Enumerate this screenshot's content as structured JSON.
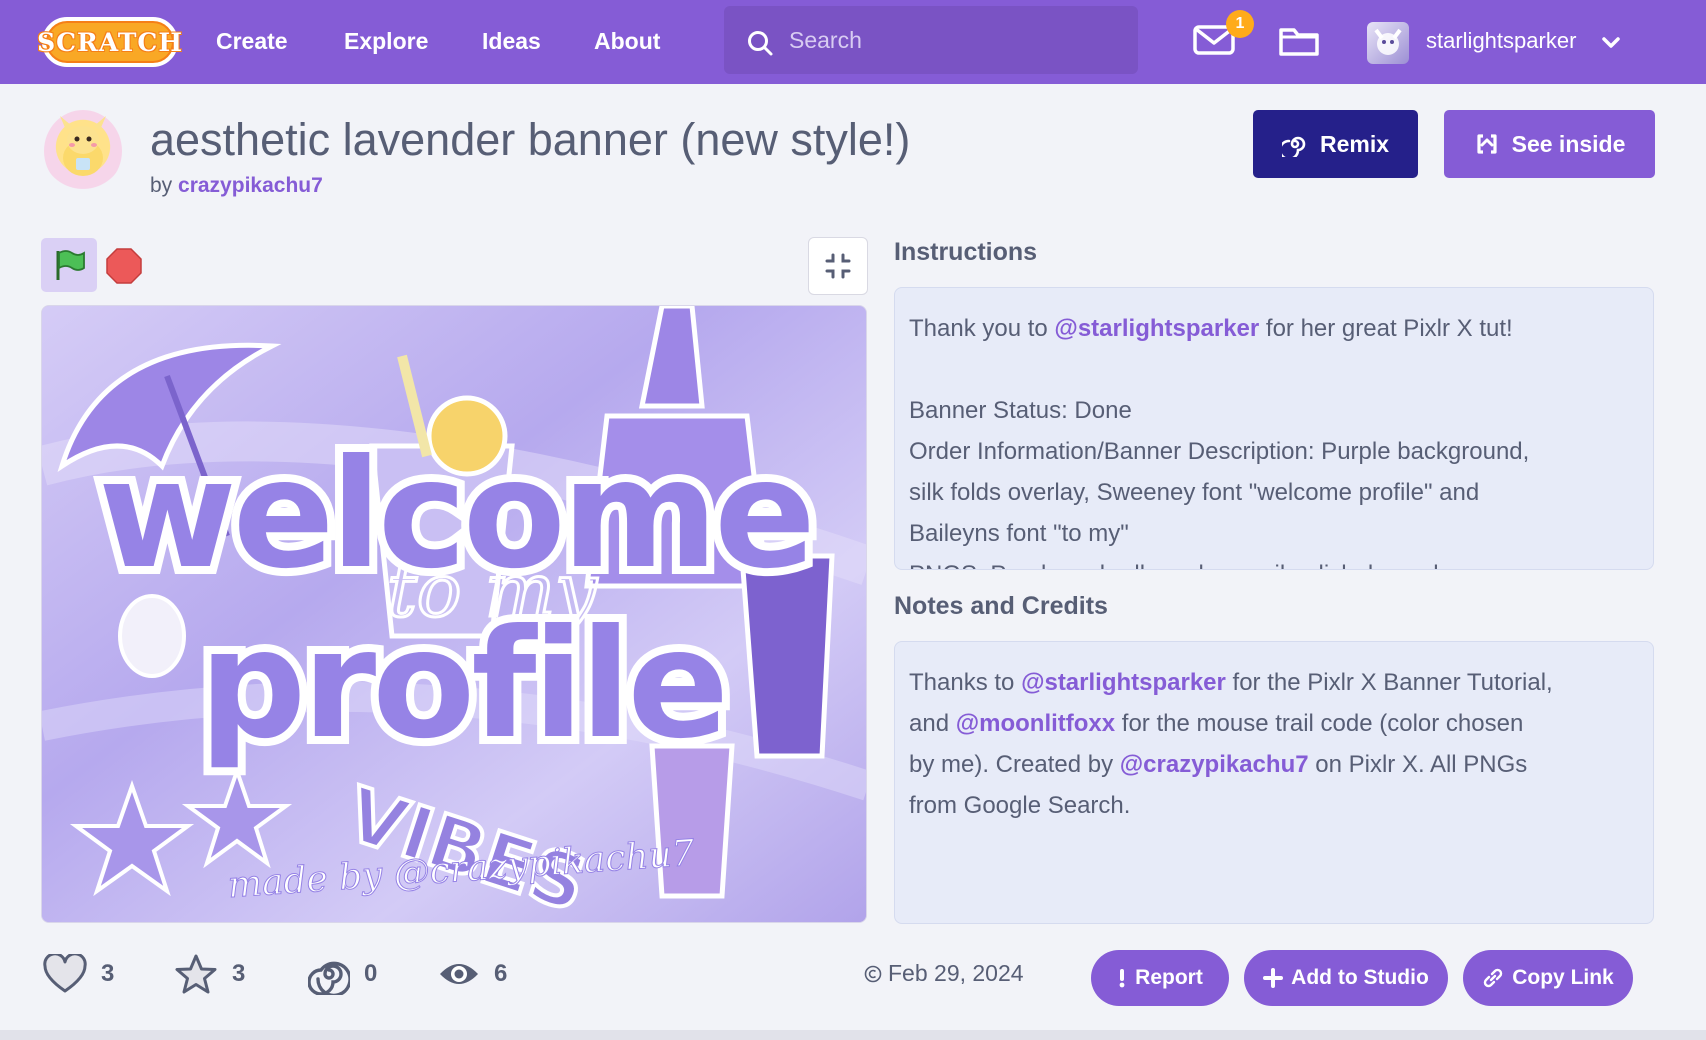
{
  "nav": {
    "logo_text": "SCRATCH",
    "links": [
      "Create",
      "Explore",
      "Ideas",
      "About"
    ],
    "search_placeholder": "Search",
    "messages_count": "1",
    "username": "starlightsparker"
  },
  "project": {
    "title": "aesthetic lavender banner (new style!)",
    "by_prefix": "by",
    "author": "crazypikachu7",
    "remix_label": "Remix",
    "see_inside_label": "See inside"
  },
  "instructions": {
    "heading": "Instructions",
    "line1_pre": "Thank you to ",
    "line1_mention": "@starlightsparker",
    "line1_post": " for her great Pixlr X tut!",
    "line3": "Banner Status: Done",
    "line4": "Order Information/Banner Description: Purple background,",
    "line5": "silk folds overlay, Sweeney font \"welcome profile\" and",
    "line6": "Baileyns font \"to my\"",
    "line7": "PNGS: Purple umbrella, galaxy nail polish, lavender"
  },
  "notes": {
    "heading": "Notes and Credits",
    "l1_pre": "Thanks to ",
    "l1_mention": "@starlightsparker",
    "l1_post": " for the Pixlr X Banner Tutorial,",
    "l2_pre": "and ",
    "l2_mention": "@moonlitfoxx",
    "l2_post": " for the mouse trail code (color chosen",
    "l3_pre": "by me). Created by ",
    "l3_mention": "@crazypikachu7",
    "l3_post": " on Pixlr X. All PNGs",
    "l4": "from Google Search."
  },
  "stage": {
    "big_word1": "welcome",
    "script_text": "to my",
    "big_word2": "profile",
    "vibes": "VIBES",
    "credit": "made by @crazypikachu7"
  },
  "stats": {
    "loves": "3",
    "favorites": "3",
    "remixes": "0",
    "views": "6"
  },
  "footer": {
    "date": "Feb 29, 2024",
    "report_label": "Report",
    "add_studio_label": "Add to Studio",
    "copy_link_label": "Copy Link"
  },
  "colors": {
    "nav_purple": "#855cd6",
    "remix_navy": "#25208a",
    "mention_purple": "#855cd6",
    "text_gray": "#575e75"
  }
}
